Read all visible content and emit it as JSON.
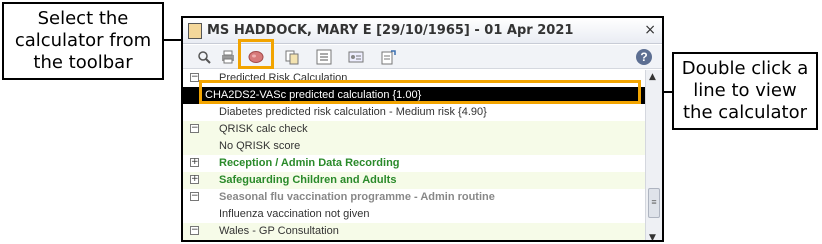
{
  "callouts": {
    "left": [
      "Select the",
      "calculator from",
      "the toolbar"
    ],
    "right": [
      "Double click a",
      "line to view",
      "the calculator"
    ]
  },
  "window": {
    "title": "MS HADDOCK, MARY E [29/10/1965] - 01 Apr 2021",
    "close_glyph": "×",
    "help_glyph": "?"
  },
  "toolbar_icons": [
    "print-preview-icon",
    "print-icon",
    "calculator-icon",
    "copy-icon",
    "list-icon",
    "id-card-icon",
    "export-icon"
  ],
  "rows": [
    {
      "text": "Predicted Risk Calculation",
      "style": "normal",
      "expander": "−"
    },
    {
      "text": "CHA2DS2-VASc predicted calculation {1.00}",
      "style": "selected",
      "expander": ""
    },
    {
      "text": "Diabetes predicted risk calculation - Medium risk {4.90}",
      "style": "normal",
      "expander": ""
    },
    {
      "text": "QRISK calc check",
      "style": "normal",
      "expander": "−"
    },
    {
      "text": "No QRISK score",
      "style": "normal",
      "expander": ""
    },
    {
      "text": "Reception / Admin Data Recording",
      "style": "green",
      "expander": "+"
    },
    {
      "text": "Safeguarding Children and Adults",
      "style": "green",
      "expander": "+"
    },
    {
      "text": "Seasonal flu vaccination programme - Admin routine",
      "style": "grey",
      "expander": "−"
    },
    {
      "text": "Influenza vaccination not given",
      "style": "normal",
      "expander": ""
    },
    {
      "text": "Wales - GP Consultation",
      "style": "normal",
      "expander": "−"
    }
  ],
  "scrollbar": {
    "up": "▲",
    "down": "▼",
    "thumb": "≡"
  }
}
